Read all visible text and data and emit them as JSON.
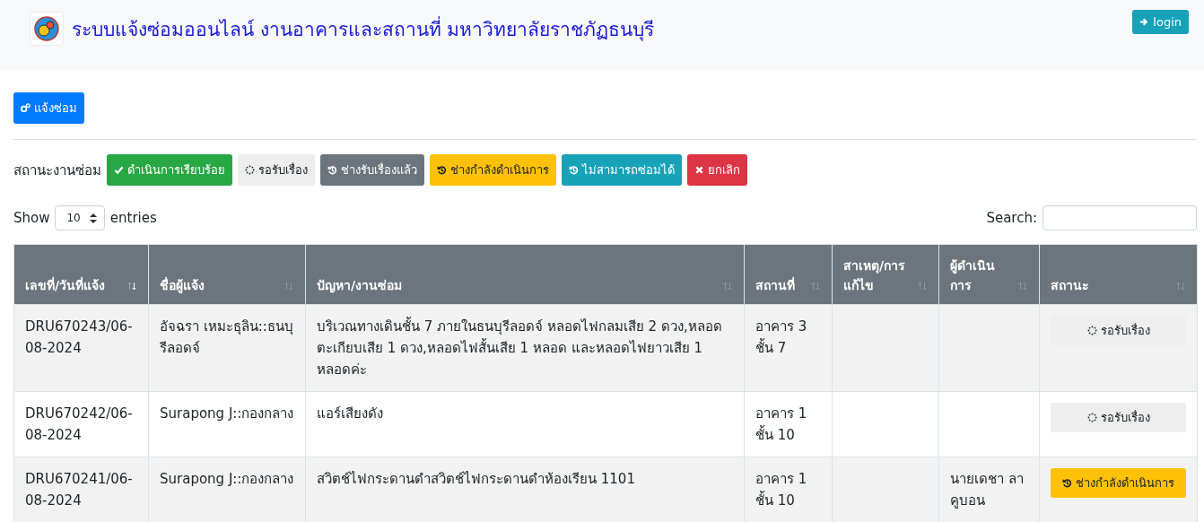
{
  "header": {
    "title": "ระบบแจ้งซ่อมออนไลน์ งานอาคารและสถานที่ มหาวิทยาลัยราชภัฏธนบุรี",
    "login_button": "login"
  },
  "report_button": "แจ้งซ่อม",
  "status_legend": {
    "label": "สถานะงานซ่อม",
    "items": [
      {
        "label": "ดำเนินการเรียบร้อย",
        "kind": "success"
      },
      {
        "label": "รอรับเรื่อง",
        "kind": "light"
      },
      {
        "label": "ช่างรับเรื่องแล้ว",
        "kind": "secondary"
      },
      {
        "label": "ช่างกำลังดำเนินการ",
        "kind": "warning"
      },
      {
        "label": "ไม่สามารถซ่อมได้",
        "kind": "info"
      },
      {
        "label": "ยกเลิก",
        "kind": "danger"
      }
    ]
  },
  "length": {
    "before": "Show",
    "value": "10",
    "after": "entries"
  },
  "search": {
    "label": "Search:"
  },
  "table": {
    "columns": [
      {
        "label": "เลขที่/วันที่แจ้ง",
        "sorted": true
      },
      {
        "label": "ชื่อผู้แจ้ง",
        "sorted": false
      },
      {
        "label": "ปัญหา/งานซ่อม",
        "sorted": false
      },
      {
        "label": "สถานที่",
        "sorted": false
      },
      {
        "label": "สาเหตุ/การแก้ไข",
        "sorted": false
      },
      {
        "label": "ผู้ดำเนินการ",
        "sorted": false
      },
      {
        "label": "สถานะ",
        "sorted": false
      }
    ],
    "rows": [
      {
        "number": "DRU670243/06-08-2024",
        "reporter": "อัจฉรา เหมะธุลิน::ธนบุรีลอดจ์",
        "problem": "บริเวณทางเดินชั้น 7 ภายในธนบุรีลอดจ์ หลอดไฟกลมเสีย 2 ดวง,หลอดตะเกียบเสีย 1 ดวง,หลอดไฟสั้นเสีย 1 หลอด และหลอดไฟยาวเสีย 1 หลอดค่ะ",
        "location": "อาคาร 3 ชั้น 7",
        "status": {
          "label": "รอรับเรื่อง",
          "kind": "light"
        }
      },
      {
        "number": "DRU670242/06-08-2024",
        "reporter": "Surapong J::กองกลาง",
        "problem": "แอร์เสียงดัง",
        "location": "อาคาร 1 ชั้น 10",
        "status": {
          "label": "รอรับเรื่อง",
          "kind": "light"
        }
      },
      {
        "number": "DRU670241/06-08-2024",
        "reporter": "Surapong J::กองกลาง",
        "problem": "สวิตช์ไฟกระดานดำสวิตช์ไฟกระดานดำห้องเรียน 1101",
        "location": "อาคาร 1 ชั้น 10",
        "operator": "นายเดชา ลาคูบอน",
        "status": {
          "label": "ช่างกำลังดำเนินการ",
          "kind": "warning"
        }
      }
    ]
  }
}
